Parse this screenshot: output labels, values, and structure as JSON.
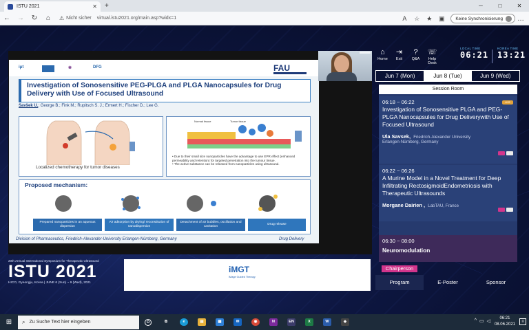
{
  "browser": {
    "tab_title": "ISTU 2021",
    "new_tab": "+",
    "insecure_label": "Nicht sicher",
    "url": "virtual.istu2021.org/main.asp?widx=1",
    "sync_label": "Keine Synchronisierung",
    "min": "─",
    "max": "□",
    "close": "✕"
  },
  "header": {
    "nav": [
      {
        "label": "Home",
        "icon": "home-icon",
        "glyph": "⌂"
      },
      {
        "label": "Exit",
        "icon": "exit-icon",
        "glyph": "⇥"
      },
      {
        "label": "Q&A",
        "icon": "qa-icon",
        "glyph": "?"
      },
      {
        "label": "Help Desk",
        "icon": "help-desk-icon",
        "glyph": "☏"
      }
    ],
    "local_label": "LOCAL TIME",
    "local_time": "06:21",
    "korea_label": "KOREA TIME",
    "korea_time": "13:21"
  },
  "slide": {
    "title": "Investigation of Sonosensitive PEG-PLGA and PLGA Nanocapsules for Drug Delivery with Use of Focused Ultrasound",
    "lead_author": "Savšek U.",
    "coauthors": "; George B.; Fink M.; Rupitsch S. J.; Ermert H.; Fischer D.; Lee G.",
    "panel_a_caption": "Localized chemotherapy for tumor diseases",
    "bullet_1": "Due to their small size nanoparticles have the advantage to use EPR effect (enhanced permeability and retention) for targeted penetration into the tumour tissue.",
    "bullet_2": "The active substance can be released from nanoparticles using ultrasound.",
    "mechanism_title": "Proposed mechanism:",
    "steps": [
      "Prepared nanoparticles in an aqueous dispersion",
      "Air adsorption by drying/ reconstitution of nanodispersion",
      "Detachment of air bubbles, oscillation and cavitation",
      "Drug release"
    ],
    "footer_left": "Division of Pharmaceutics, Friedrich-Alexander-University Erlangen-Nürnberg, Germany",
    "footer_right": "Drug Delivery",
    "logo_fau": "FAU",
    "normal_tissue": "Normal tissue",
    "tumor_tissue": "Tumor tissue"
  },
  "banner": {
    "top": "20th Annual International Symposium for Therapeutic Ultrasound",
    "big": "ISTU 2021",
    "sub": "HICO, Gyeongju, Korea | JUNE 6 (Sun) ~ 9 (Wed), 2021",
    "sponsor_logo": "iMGT",
    "sponsor_sub": "IMage Guided Therapy"
  },
  "program": {
    "days": [
      "Jun 7 (Mon)",
      "Jun 8 (Tue)",
      "Jun 9 (Wed)"
    ],
    "active_day": 1,
    "session_room": "Session Room",
    "sessions": [
      {
        "time": "06:18 ~ 06:22",
        "badge": "LIVE",
        "title": "Investigation of Sonosensitive PLGA and PEG-PLGA Nanocapsules for Drug Deliverywith Use of Focused Ultrasound",
        "speaker": "Ula Savsek",
        "affiliation": "Friedrich-Alexander University",
        "affiliation2": "Erlangen-Nürnberg, Germany"
      },
      {
        "time": "06:22 ~ 06:26",
        "title": "A Murine Model in a Novel Treatment for Deep Infiltrating RectosigmoidEndometriosis with Therapeutic Ultrasounds",
        "speaker": "Morgane Dairien",
        "affiliation": "LabTAU, France"
      }
    ],
    "block_time": "06:30 ~ 08:00",
    "block_title": "Neuromodulation",
    "chair": "Chairperson"
  },
  "bottomnav": [
    "Program",
    "E-Poster",
    "Sponsor"
  ],
  "taskbar": {
    "search_placeholder": "Zu Suche Text hier eingeben",
    "time": "06:21",
    "date": "08.06.2021",
    "apps": [
      "O",
      "⧉",
      "e",
      "▤",
      "▦",
      "✉",
      "◉",
      "N",
      "EN",
      "X",
      "W",
      "◈"
    ]
  },
  "colors": {
    "accent": "#2b6aae",
    "badge": "#e3a33a",
    "chair": "#d3358c",
    "program_bg": "#263a6e"
  }
}
